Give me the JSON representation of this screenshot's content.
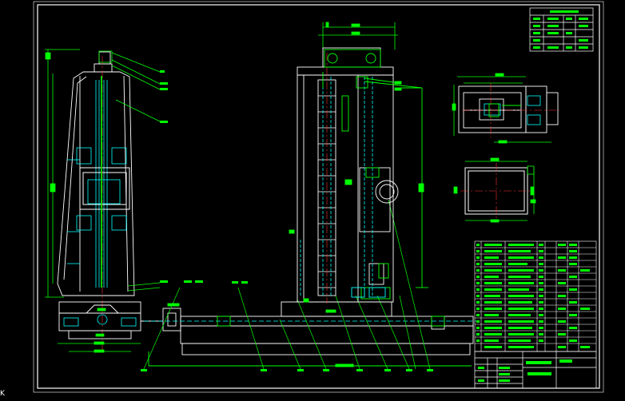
{
  "viewport": {
    "corner_glyph": "K"
  },
  "drawing": {
    "background_color": "#000000",
    "line_colors": {
      "frame": "#ffffff",
      "dimension": "#00ff00",
      "part": "#ffffff",
      "hidden": "#00ffff",
      "center": "#ff3030",
      "hatch": "#00ffff"
    }
  }
}
